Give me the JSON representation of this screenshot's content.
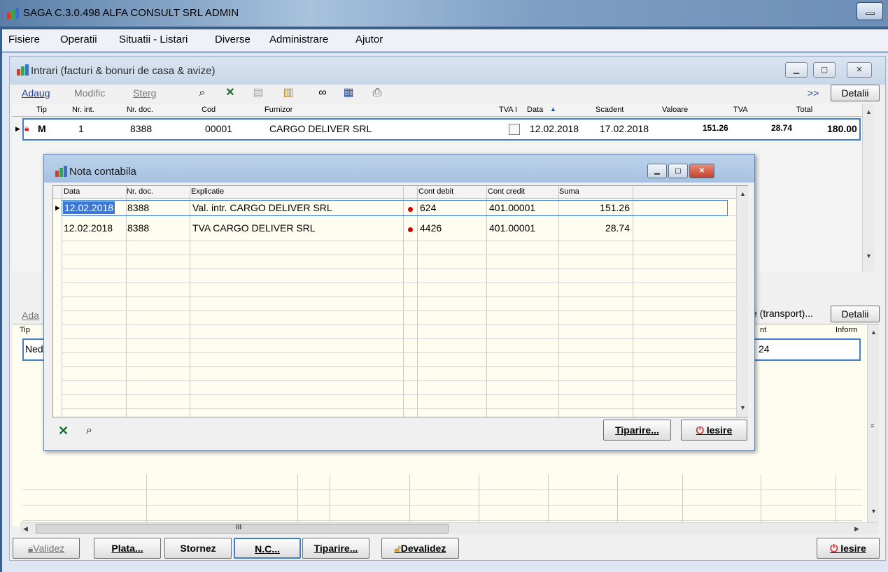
{
  "app": {
    "title": "SAGA C.3.0.498  ALFA CONSULT SRL  ADMIN"
  },
  "menu": [
    "Fisiere",
    "Operatii",
    "Situatii - Listari",
    "Diverse",
    "Administrare",
    "Ajutor"
  ],
  "intrari": {
    "title": "Intrari (facturi & bonuri de casa & avize)",
    "toolbar": {
      "adaug": "Adaug",
      "modific": "Modific",
      "sterg": "Sterg",
      "more": ">>",
      "detalii": "Detalii"
    },
    "icons": [
      "binoculars-icon",
      "excel-icon",
      "copy-icon",
      "paste-icon",
      "link-icon",
      "table-icon",
      "print-icon"
    ],
    "columns": [
      "Tip",
      "Nr. int.",
      "Nr. doc.",
      "Cod",
      "Furnizor",
      "TVA I",
      "Data",
      "Scadent",
      "Valoare",
      "TVA",
      "Total"
    ],
    "row": {
      "tip": "M",
      "nr_int": "1",
      "nr_doc": "8388",
      "cod": "00001",
      "furnizor": "CARGO DELIVER SRL",
      "data": "12.02.2018",
      "scadent": "17.02.2018",
      "valoare": "151.26",
      "tva": "28.74",
      "total": "180.00"
    }
  },
  "lower": {
    "adaug_partial": "Ada",
    "transport_button": "e (transport)...",
    "detalii": "Detalii",
    "col_tip": "Tip",
    "col_nt": "nt",
    "col_inform": "Inform",
    "row_tip": "Ned",
    "row_val": "24"
  },
  "bottom_buttons": {
    "validez": "Validez",
    "plata": "Plata...",
    "stornez": "Stornez",
    "nc": "N.C...",
    "tiparire": "Tiparire...",
    "devalidez": "Devalidez",
    "iesire": "Iesire"
  },
  "nota": {
    "title": "Nota contabila",
    "columns": [
      "Data",
      "Nr. doc.",
      "Explicatie",
      "Cont debit",
      "Cont credit",
      "Suma"
    ],
    "rows": [
      {
        "data": "12.02.2018",
        "nr_doc": "8388",
        "explicatie": "Val. intr. CARGO DELIVER SRL",
        "cont_debit": "624",
        "cont_credit": "401.00001",
        "suma": "151.26"
      },
      {
        "data": "12.02.2018",
        "nr_doc": "8388",
        "explicatie": "TVA CARGO DELIVER SRL",
        "cont_debit": "4426",
        "cont_credit": "401.00001",
        "suma": "28.74"
      }
    ],
    "tiparire": "Tiparire...",
    "iesire": "Iesire"
  },
  "scrollbar_marker": "III"
}
